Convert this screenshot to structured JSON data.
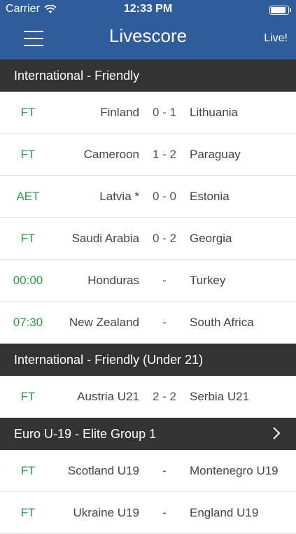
{
  "status_bar": {
    "carrier": "Carrier",
    "time": "12:33 PM",
    "battery_level": 0.95
  },
  "nav": {
    "title": "Livescore",
    "live_label": "Live!"
  },
  "colors": {
    "header": "#2f5d9b",
    "section": "#333333",
    "status_green": "#2f9a4a"
  },
  "sections": [
    {
      "title": "International - Friendly",
      "has_chevron": false,
      "matches": [
        {
          "status": "FT",
          "home": "Finland",
          "score": "0 - 1",
          "away": "Lithuania"
        },
        {
          "status": "FT",
          "home": "Cameroon",
          "score": "1 - 2",
          "away": "Paraguay"
        },
        {
          "status": "AET",
          "home": "Latvia *",
          "score": "0 - 0",
          "away": "Estonia"
        },
        {
          "status": "FT",
          "home": "Saudi Arabia",
          "score": "0 - 2",
          "away": "Georgia"
        },
        {
          "status": "00:00",
          "home": "Honduras",
          "score": "-",
          "away": "Turkey"
        },
        {
          "status": "07:30",
          "home": "New Zealand",
          "score": "-",
          "away": "South Africa"
        }
      ]
    },
    {
      "title": "International - Friendly (Under 21)",
      "has_chevron": false,
      "matches": [
        {
          "status": "FT",
          "home": "Austria U21",
          "score": "2 - 2",
          "away": "Serbia U21"
        }
      ]
    },
    {
      "title": "Euro U-19 - Elite Group 1",
      "has_chevron": true,
      "matches": [
        {
          "status": "FT",
          "home": "Scotland U19",
          "score": "-",
          "away": "Montenegro U19"
        },
        {
          "status": "FT",
          "home": "Ukraine U19",
          "score": "-",
          "away": "England U19"
        }
      ]
    }
  ]
}
